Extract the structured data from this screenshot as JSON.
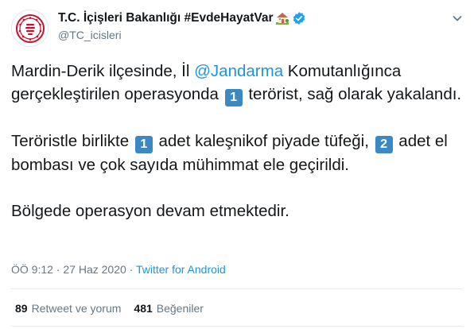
{
  "author": {
    "display_name": "T.C. İçişleri Bakanlığı #EvdeHayatVar",
    "handle": "@TC_icisleri",
    "verified": true,
    "avatar_icon": "ministry-seal-icon",
    "name_emoji": "house-with-garden-icon"
  },
  "tweet": {
    "p1": {
      "before_mention": "Mardin-Derik ilçesinde, İl ",
      "mention": "@Jandarma",
      "after_mention": " Komutanlığınca gerçekleştirilen operasyonda ",
      "keycap": "1",
      "end": " terörist, sağ olarak yakalandı."
    },
    "p2": {
      "start": "Teröristle birlikte ",
      "keycap1": "1",
      "middle": " adet kaleşnikof piyade tüfeği, ",
      "keycap2": "2",
      "end": " adet el bombası ve çok sayıda mühimmat ele geçirildi."
    },
    "p3": "Bölgede operasyon devam etmektedir."
  },
  "meta": {
    "time": "ÖÖ 9:12",
    "separator1": " · ",
    "date": "27 Haz 2020",
    "separator2": " · ",
    "source": "Twitter for Android"
  },
  "stats": {
    "retweets_count": "89",
    "retweets_label": "Retweet ve yorum",
    "likes_count": "481",
    "likes_label": "Beğeniler"
  },
  "colors": {
    "link": "#1b95e0",
    "verified": "#1da1f2",
    "keycap": "#3b88c3",
    "seal": "#c8102e"
  }
}
